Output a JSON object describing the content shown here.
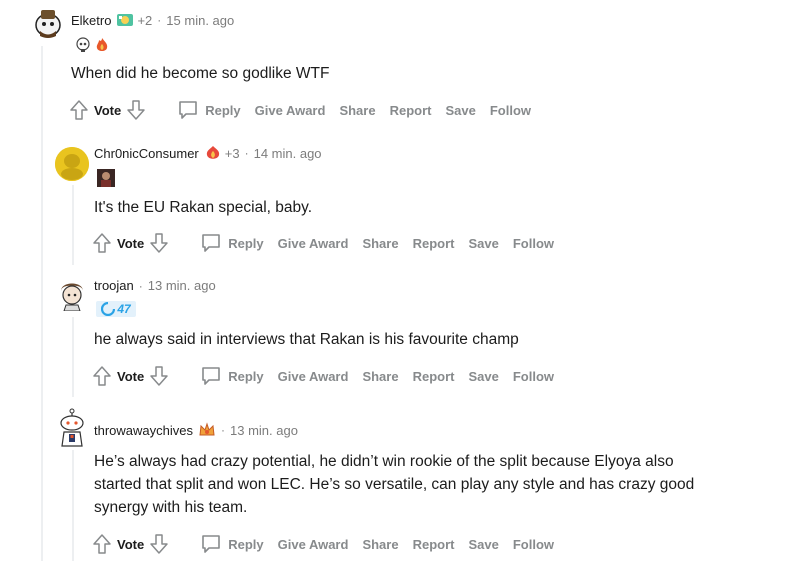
{
  "comments": [
    {
      "username": "Elketro",
      "award_count": "+2",
      "timestamp": "15 min. ago",
      "body": "When did he become so godlike WTF",
      "flairs": [
        "skull-flair",
        "fire-flair"
      ]
    },
    {
      "username": "Chr0nicConsumer",
      "award_count": "+3",
      "timestamp": "14 min. ago",
      "body": "It's the EU Rakan special, baby.",
      "flairs": [
        "portrait-flair"
      ]
    },
    {
      "username": "troojan",
      "award_count": "",
      "timestamp": "13 min. ago",
      "body": "he always said in interviews that Rakan is his favourite champ",
      "flairs": [
        "team-47-flair"
      ]
    },
    {
      "username": "throwawaychives",
      "award_count": "",
      "timestamp": "13 min. ago",
      "body_lines": [
        "He’s always had crazy potential, he didn’t win rookie of the split because Elyoya also",
        "started that split and won LEC. He’s so versatile, can play any style and has crazy good",
        "synergy with his team."
      ],
      "flairs": []
    }
  ],
  "actions": {
    "vote": "Vote",
    "reply": "Reply",
    "give_award": "Give Award",
    "share": "Share",
    "report": "Report",
    "save": "Save",
    "follow": "Follow"
  },
  "flair_text": {
    "team": "47"
  },
  "colors": {
    "meta_gray": "#7c7c7c",
    "action_gray": "#878a8c",
    "text": "#1c1c1c",
    "thread_line": "#edeff1"
  }
}
